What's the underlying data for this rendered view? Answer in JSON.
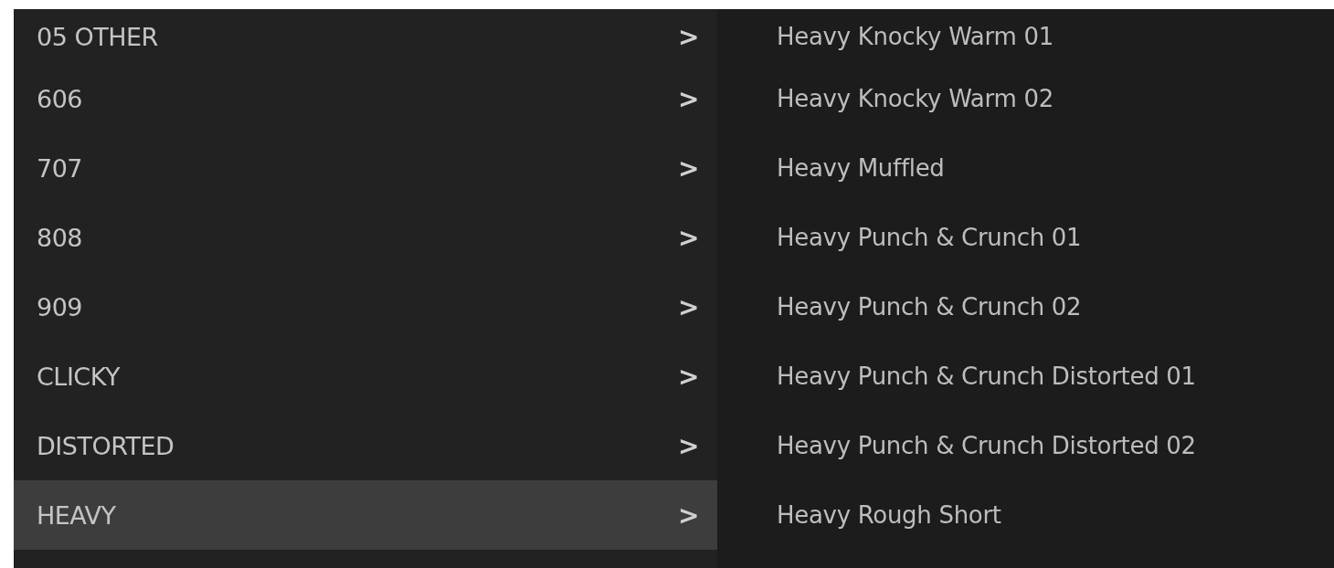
{
  "categories": [
    {
      "label": "05  OTHER",
      "selected": false,
      "arrow": ">"
    },
    {
      "label": "606",
      "selected": false,
      "arrow": ">"
    },
    {
      "label": "707",
      "selected": false,
      "arrow": ">"
    },
    {
      "label": "808",
      "selected": false,
      "arrow": ">"
    },
    {
      "label": "909",
      "selected": false,
      "arrow": ">"
    },
    {
      "label": "CLICKY",
      "selected": false,
      "arrow": ">"
    },
    {
      "label": "DISTORTED",
      "selected": false,
      "arrow": ">"
    },
    {
      "label": "HEAVY",
      "selected": true,
      "arrow": ">"
    }
  ],
  "presets": [
    {
      "label": "Heavy Knocky Warm 01"
    },
    {
      "label": "Heavy Knocky Warm 02"
    },
    {
      "label": "Heavy Muffled"
    },
    {
      "label": "Heavy Punch & Crunch 01"
    },
    {
      "label": "Heavy Punch & Crunch 02"
    },
    {
      "label": "Heavy Punch & Crunch Distorted 01"
    },
    {
      "label": "Heavy Punch & Crunch Distorted 02"
    },
    {
      "label": "Heavy Rough Short"
    }
  ]
}
